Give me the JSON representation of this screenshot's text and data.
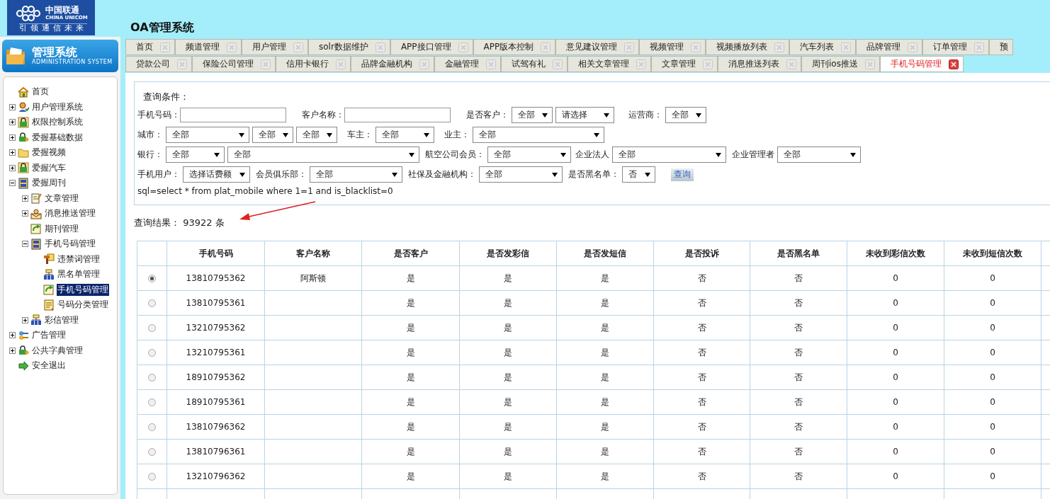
{
  "header": {
    "logo": {
      "name_cn": "中国联通",
      "name_en": "CHINA UNICOM",
      "slogan": "引领通信未来"
    },
    "title": "OA管理系统"
  },
  "sidebar": {
    "banner": {
      "title": "管理系统",
      "subtitle": "ADMINISTRATION SYSTEM"
    },
    "tree": [
      {
        "label": "首页",
        "kind": "home",
        "selected": false
      },
      {
        "label": "用户管理系统",
        "kind": "user",
        "expanded": false,
        "selected": false
      },
      {
        "label": "权限控制系统",
        "kind": "lock",
        "expanded": false,
        "selected": false
      },
      {
        "label": "爱握基础数据",
        "kind": "lock-key",
        "expanded": false,
        "selected": false
      },
      {
        "label": "爱握视频",
        "kind": "folder",
        "expanded": false,
        "selected": false
      },
      {
        "label": "爱握汽车",
        "kind": "lock",
        "expanded": false,
        "selected": false
      },
      {
        "label": "爱握周刊",
        "kind": "cabinet",
        "expanded": true,
        "selected": false,
        "children": [
          {
            "label": "文章管理",
            "kind": "note-pen",
            "expanded": false,
            "selected": false
          },
          {
            "label": "消息推送管理",
            "kind": "mail",
            "expanded": false,
            "selected": false
          },
          {
            "label": "期刊管理",
            "kind": "page-arrow",
            "selected": false
          },
          {
            "label": "手机号码管理",
            "kind": "cabinet",
            "expanded": true,
            "selected": false,
            "children": [
              {
                "label": "违禁词管理",
                "kind": "hammer",
                "selected": false
              },
              {
                "label": "黑名单管理",
                "kind": "network",
                "selected": false
              },
              {
                "label": "手机号码管理",
                "kind": "page-arrow",
                "selected": true
              },
              {
                "label": "号码分类管理",
                "kind": "note",
                "selected": false
              }
            ]
          },
          {
            "label": "彩信管理",
            "kind": "network",
            "expanded": false,
            "selected": false
          }
        ]
      },
      {
        "label": "广告管理",
        "kind": "keys",
        "expanded": false,
        "selected": false
      },
      {
        "label": "公共字典管理",
        "kind": "lock-key",
        "expanded": false,
        "selected": false
      },
      {
        "label": "安全退出",
        "kind": "exit",
        "selected": false
      }
    ]
  },
  "tabs": [
    [
      {
        "label": "首页",
        "selected": false
      },
      {
        "label": "频道管理",
        "selected": false
      },
      {
        "label": "用户管理",
        "selected": false
      },
      {
        "label": "solr数据维护",
        "selected": false
      },
      {
        "label": "APP接口管理",
        "selected": false
      },
      {
        "label": "APP版本控制",
        "selected": false
      },
      {
        "label": "意见建议管理",
        "selected": false
      },
      {
        "label": "视频管理",
        "selected": false
      },
      {
        "label": "视频播放列表",
        "selected": false
      },
      {
        "label": "汽车列表",
        "selected": false
      },
      {
        "label": "品牌管理",
        "selected": false
      },
      {
        "label": "订单管理",
        "selected": false
      },
      {
        "label": "预",
        "selected": false
      }
    ],
    [
      {
        "label": "贷款公司",
        "selected": false
      },
      {
        "label": "保险公司管理",
        "selected": false
      },
      {
        "label": "信用卡银行",
        "selected": false
      },
      {
        "label": "品牌金融机构",
        "selected": false
      },
      {
        "label": "金融管理",
        "selected": false
      },
      {
        "label": "试驾有礼",
        "selected": false
      },
      {
        "label": "相关文章管理",
        "selected": false
      },
      {
        "label": "文章管理",
        "selected": false
      },
      {
        "label": "消息推送列表",
        "selected": false
      },
      {
        "label": "周刊ios推送",
        "selected": false
      },
      {
        "label": "手机号码管理",
        "selected": true
      }
    ]
  ],
  "query": {
    "title": "查询条件：",
    "filters": [
      {
        "label": "手机号码：",
        "controls": [
          {
            "kind": "input"
          }
        ]
      },
      {
        "label": "客户名称：",
        "controls": [
          {
            "kind": "input"
          }
        ]
      },
      {
        "label": "是否客户：",
        "controls": [
          {
            "kind": "select",
            "value": "全部"
          },
          {
            "kind": "select",
            "value": "请选择"
          }
        ]
      },
      {
        "label": "运营商：",
        "controls": [
          {
            "kind": "select",
            "value": "全部"
          }
        ]
      },
      {
        "label": "城市：",
        "controls": [
          {
            "kind": "select",
            "value": "全部"
          },
          {
            "kind": "select",
            "value": "全部"
          },
          {
            "kind": "select",
            "value": "全部"
          }
        ]
      },
      {
        "label": "车主：",
        "controls": [
          {
            "kind": "select",
            "value": "全部"
          }
        ]
      },
      {
        "label": "业主：",
        "controls": [
          {
            "kind": "select",
            "value": "全部"
          }
        ]
      },
      {
        "label": "银行：",
        "controls": [
          {
            "kind": "select",
            "value": "全部"
          },
          {
            "kind": "select",
            "value": "全部"
          }
        ]
      },
      {
        "label": "航空公司会员：",
        "controls": [
          {
            "kind": "select",
            "value": "全部"
          }
        ]
      },
      {
        "label": "企业法人",
        "controls": [
          {
            "kind": "select",
            "value": "全部"
          }
        ]
      },
      {
        "label": "企业管理者",
        "controls": [
          {
            "kind": "select",
            "value": "全部"
          }
        ]
      },
      {
        "label": "手机用户：",
        "controls": [
          {
            "kind": "select",
            "value": "选择话费额"
          }
        ]
      },
      {
        "label": "会员俱乐部：",
        "controls": [
          {
            "kind": "select",
            "value": "全部"
          }
        ]
      },
      {
        "label": "社保及金融机构：",
        "controls": [
          {
            "kind": "select",
            "value": "全部"
          }
        ]
      },
      {
        "label": "是否黑名单：",
        "controls": [
          {
            "kind": "select",
            "value": "否"
          },
          {
            "kind": "button",
            "text": "查询"
          }
        ]
      }
    ],
    "sql": "sql=select * from plat_mobile where 1=1 and is_blacklist=0"
  },
  "result": "查询结果： 93922 条",
  "table": {
    "columns": [
      "手机号码",
      "客户名称",
      "是否客户",
      "是否发彩信",
      "是否发短信",
      "是否投诉",
      "是否黑名单",
      "未收到彩信次数",
      "未收到短信次数"
    ],
    "rows": [
      {
        "selected": true,
        "cells": [
          "13810795362",
          "阿斯顿",
          "是",
          "是",
          "是",
          "否",
          "否",
          "0",
          "0"
        ]
      },
      {
        "selected": false,
        "cells": [
          "13810795361",
          null,
          "是",
          "是",
          "是",
          "否",
          "否",
          "0",
          "0"
        ]
      },
      {
        "selected": false,
        "cells": [
          "13210795362",
          null,
          "是",
          "是",
          "是",
          "否",
          "否",
          "0",
          "0"
        ]
      },
      {
        "selected": false,
        "cells": [
          "13210795361",
          null,
          "是",
          "是",
          "是",
          "否",
          "否",
          "0",
          "0"
        ]
      },
      {
        "selected": false,
        "cells": [
          "18910795362",
          null,
          "是",
          "是",
          "是",
          "否",
          "否",
          "0",
          "0"
        ]
      },
      {
        "selected": false,
        "cells": [
          "18910795361",
          null,
          "是",
          "是",
          "是",
          "否",
          "否",
          "0",
          "0"
        ]
      },
      {
        "selected": false,
        "cells": [
          "13810796362",
          null,
          "是",
          "是",
          "是",
          "否",
          "否",
          "0",
          "0"
        ]
      },
      {
        "selected": false,
        "cells": [
          "13810796361",
          null,
          "是",
          "是",
          "是",
          "否",
          "否",
          "0",
          "0"
        ]
      },
      {
        "selected": false,
        "cells": [
          "13210796362",
          null,
          "是",
          "是",
          "是",
          "否",
          "否",
          "0",
          "0"
        ]
      }
    ]
  }
}
